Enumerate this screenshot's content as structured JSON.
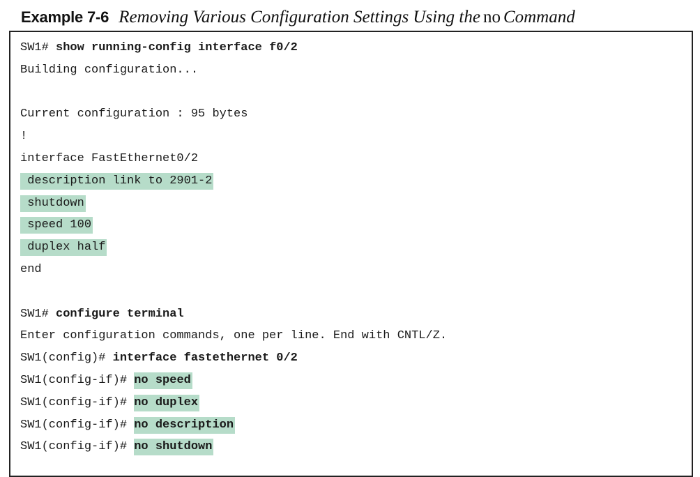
{
  "caption": {
    "label": "Example 7-6",
    "title_before": "Removing Various Configuration Settings Using the",
    "title_keyword": "no",
    "title_after": "Command"
  },
  "code_lines": [
    {
      "plain": "SW1# ",
      "cmd": "show running-config interface f0/2",
      "cmd_highlighted": false
    },
    {
      "plain": "Building configuration...",
      "highlighted": false
    },
    {
      "plain": "",
      "highlighted": false
    },
    {
      "plain": "Current configuration : 95 bytes",
      "highlighted": false
    },
    {
      "plain": "!",
      "highlighted": false
    },
    {
      "plain": "interface FastEthernet0/2",
      "highlighted": false
    },
    {
      "plain": " description link to 2901-2",
      "highlighted": true
    },
    {
      "plain": " shutdown",
      "highlighted": true
    },
    {
      "plain": " speed 100",
      "highlighted": true
    },
    {
      "plain": " duplex half",
      "highlighted": true
    },
    {
      "plain": "end",
      "highlighted": false
    },
    {
      "plain": "",
      "highlighted": false
    },
    {
      "plain": "SW1# ",
      "cmd": "configure terminal",
      "cmd_highlighted": false
    },
    {
      "plain": "Enter configuration commands, one per line. End with CNTL/Z.",
      "highlighted": false
    },
    {
      "plain": "SW1(config)# ",
      "cmd": "interface fastethernet 0/2",
      "cmd_highlighted": false
    },
    {
      "plain": "SW1(config-if)# ",
      "cmd": "no speed",
      "cmd_highlighted": true
    },
    {
      "plain": "SW1(config-if)# ",
      "cmd": "no duplex",
      "cmd_highlighted": true
    },
    {
      "plain": "SW1(config-if)# ",
      "cmd": "no description",
      "cmd_highlighted": true
    },
    {
      "plain": "SW1(config-if)# ",
      "cmd": "no shutdown",
      "cmd_highlighted": true
    }
  ],
  "colors": {
    "highlight": "#b6dcc9",
    "text": "#1a1a1a",
    "border": "#222222"
  }
}
